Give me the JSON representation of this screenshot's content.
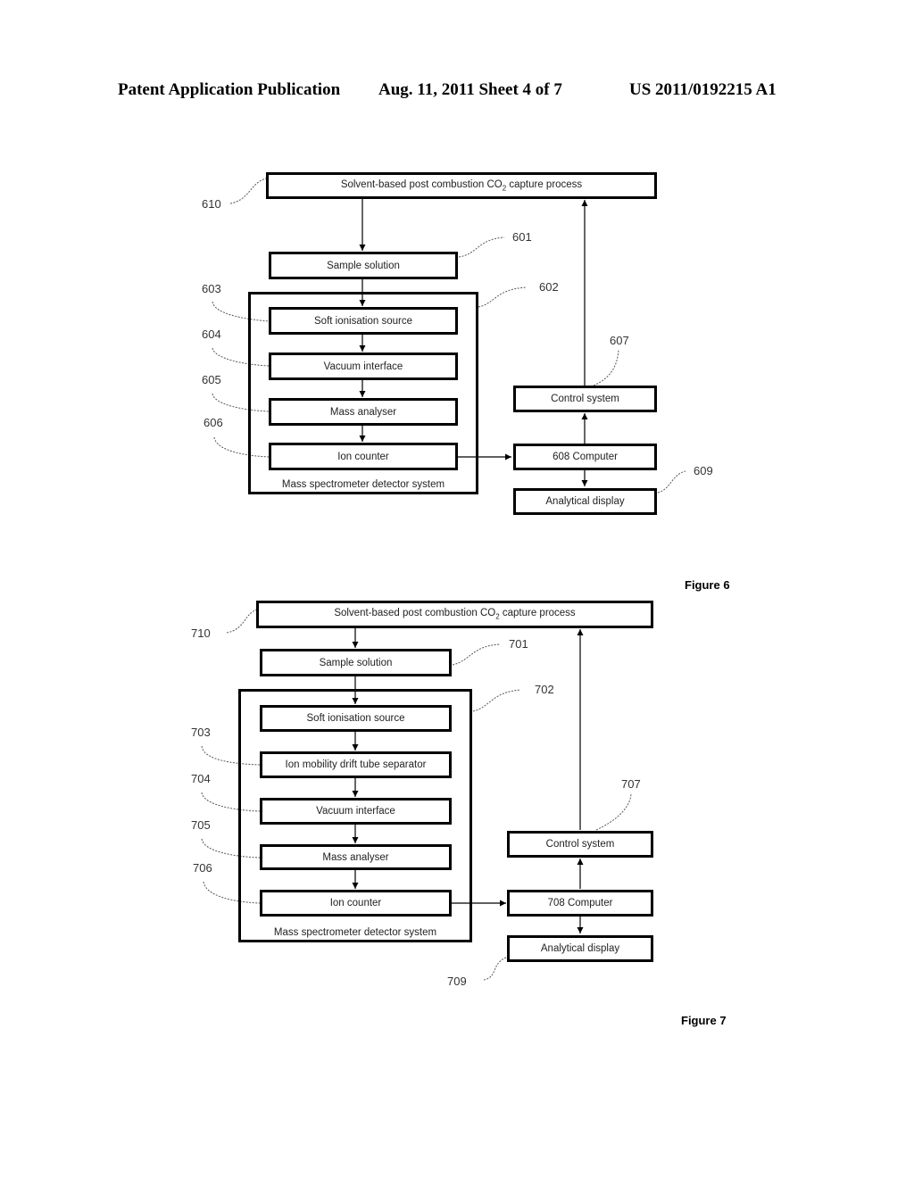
{
  "header": {
    "publication": "Patent Application Publication",
    "date_sheet": "Aug. 11, 2011  Sheet 4 of 7",
    "number": "US 2011/0192215 A1"
  },
  "figure6": {
    "caption": "Figure 6",
    "process": {
      "text_pre": "Solvent-based post combustion CO",
      "text_sub": "2",
      "text_post": " capture process",
      "ref": "610"
    },
    "sample": {
      "text": "Sample solution",
      "ref": "601"
    },
    "group": {
      "label": "Mass spectrometer detector system",
      "ref": "602"
    },
    "soft_ion": {
      "text": "Soft ionisation source",
      "ref": "603"
    },
    "vacuum": {
      "text": "Vacuum interface",
      "ref": "604"
    },
    "mass": {
      "text": "Mass analyser",
      "ref": "605"
    },
    "ion_counter": {
      "text": "Ion counter",
      "ref": "606"
    },
    "control": {
      "text": "Control system",
      "ref": "607"
    },
    "computer": {
      "text": "608 Computer"
    },
    "display": {
      "text": "Analytical display",
      "ref": "609"
    }
  },
  "figure7": {
    "caption": "Figure 7",
    "process": {
      "text_pre": "Solvent-based post combustion CO",
      "text_sub": "2",
      "text_post": " capture process",
      "ref": "710"
    },
    "sample": {
      "text": "Sample solution",
      "ref": "701"
    },
    "group": {
      "label": "Mass spectrometer detector system",
      "ref": "702"
    },
    "soft_ion": {
      "text": "Soft ionisation source"
    },
    "drift": {
      "text": "Ion mobility drift tube separator",
      "ref": "703"
    },
    "vacuum": {
      "text": "Vacuum interface",
      "ref": "704"
    },
    "mass": {
      "text": "Mass analyser",
      "ref": "705"
    },
    "ion_counter": {
      "text": "Ion counter",
      "ref": "706"
    },
    "control": {
      "text": "Control system",
      "ref": "707"
    },
    "computer": {
      "text": "708 Computer"
    },
    "display": {
      "text": "Analytical display",
      "ref": "709"
    }
  }
}
